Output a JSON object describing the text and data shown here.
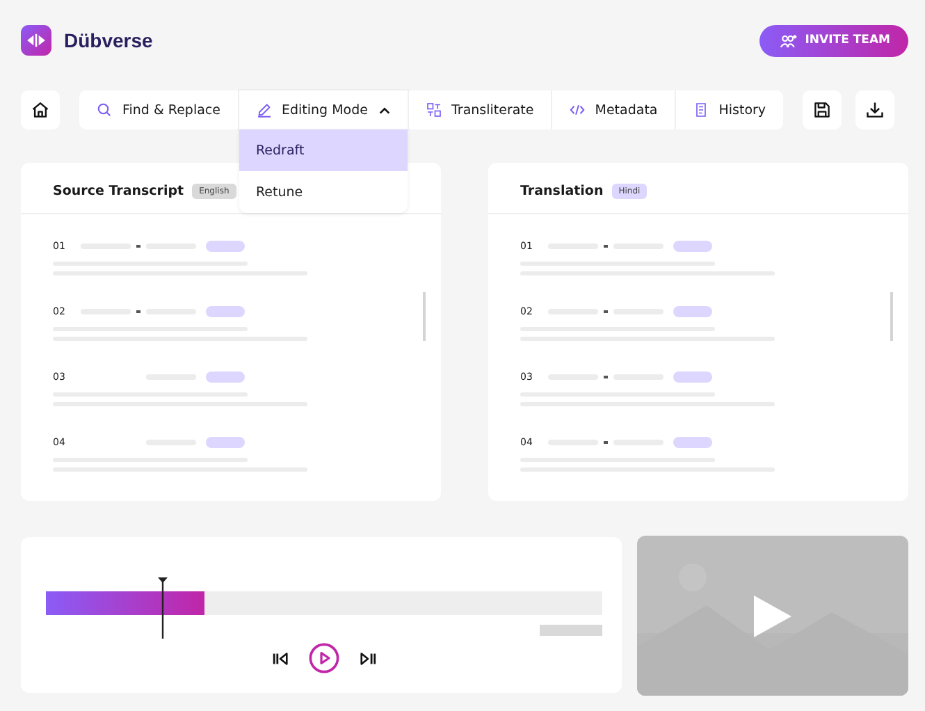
{
  "brand": {
    "name": "Dübverse"
  },
  "invite_button": {
    "label": "INVITE TEAM"
  },
  "toolbar": {
    "tabs": [
      {
        "kind": "search",
        "label": "Find & Replace",
        "expanded": false
      },
      {
        "kind": "pen",
        "label": "Editing Mode",
        "expanded": true
      },
      {
        "kind": "translit",
        "label": "Transliterate",
        "expanded": false
      },
      {
        "kind": "code",
        "label": "Metadata",
        "expanded": false
      },
      {
        "kind": "scroll",
        "label": "History",
        "expanded": false
      }
    ]
  },
  "dropdown": {
    "items": [
      {
        "label": "Redraft",
        "selected": true
      },
      {
        "label": "Retune",
        "selected": false
      }
    ]
  },
  "panels": [
    {
      "title": "Source Transcript",
      "badge": {
        "label": "English",
        "color": "#d9d9d9"
      },
      "segments": [
        {
          "number": "01",
          "kind": "range"
        },
        {
          "number": "02",
          "kind": "range"
        },
        {
          "number": "03",
          "kind": "single"
        },
        {
          "number": "04",
          "kind": "single"
        }
      ]
    },
    {
      "title": "Translation",
      "badge": {
        "label": "Hindi",
        "color": "#ddd6fe"
      },
      "segments": [
        {
          "number": "01",
          "kind": "range"
        },
        {
          "number": "02",
          "kind": "range"
        },
        {
          "number": "03",
          "kind": "range"
        },
        {
          "number": "04",
          "kind": "range"
        }
      ]
    }
  ],
  "player": {
    "progress": {
      "level": 0.285
    },
    "playhead": {
      "level": 0.21
    }
  }
}
